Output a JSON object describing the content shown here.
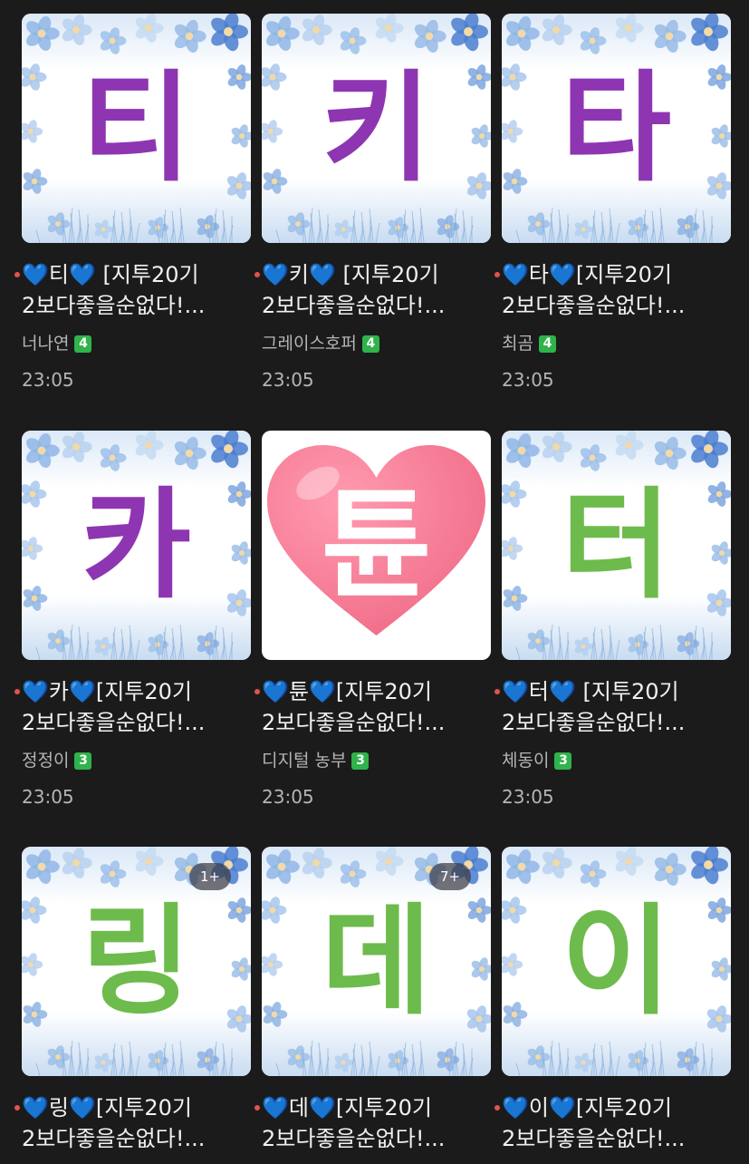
{
  "colors": {
    "background": "#1b1b1c",
    "purple_glyph": "#8e35b2",
    "green_glyph": "#6dbb4c",
    "heart": "#f06a86",
    "unread_dot": "#e0544a",
    "level_badge": "#2fb34a"
  },
  "posts": [
    {
      "glyph": "티",
      "glyph_color": "#8e35b2",
      "thumb_style": "flower-frame",
      "badge": "",
      "title_line1": "💙티💙 [지투20기",
      "title_line2": "2보다좋을순없다!...",
      "author": "너나연",
      "level": "4",
      "time": "23:05"
    },
    {
      "glyph": "키",
      "glyph_color": "#8e35b2",
      "thumb_style": "flower-frame",
      "badge": "",
      "title_line1": "💙키💙 [지투20기",
      "title_line2": "2보다좋을순없다!...",
      "author": "그레이스호퍼",
      "level": "4",
      "time": "23:05"
    },
    {
      "glyph": "타",
      "glyph_color": "#8e35b2",
      "thumb_style": "flower-frame",
      "badge": "",
      "title_line1": "💙타💙[지투20기",
      "title_line2": "2보다좋을순없다!...",
      "author": "최곰",
      "level": "4",
      "time": "23:05"
    },
    {
      "glyph": "카",
      "glyph_color": "#8e35b2",
      "thumb_style": "flower-frame",
      "badge": "",
      "title_line1": "💙카💙[지투20기",
      "title_line2": "2보다좋을순없다!...",
      "author": "정정이",
      "level": "3",
      "time": "23:05"
    },
    {
      "glyph": "튠",
      "glyph_color": "#ffffff",
      "thumb_style": "heart",
      "badge": "",
      "title_line1": "💙튠💙[지투20기",
      "title_line2": "2보다좋을순없다!...",
      "author": "디지털 농부",
      "level": "3",
      "time": "23:05"
    },
    {
      "glyph": "터",
      "glyph_color": "#6dbb4c",
      "thumb_style": "flower-frame",
      "badge": "",
      "title_line1": "💙터💙 [지투20기",
      "title_line2": "2보다좋을순없다!...",
      "author": "체동이",
      "level": "3",
      "time": "23:05"
    },
    {
      "glyph": "링",
      "glyph_color": "#6dbb4c",
      "thumb_style": "flower-frame",
      "badge": "1+",
      "title_line1": "💙링💙[지투20기",
      "title_line2": "2보다좋을순없다!...",
      "author": "",
      "level": "",
      "time": ""
    },
    {
      "glyph": "데",
      "glyph_color": "#6dbb4c",
      "thumb_style": "flower-frame",
      "badge": "7+",
      "title_line1": "💙데💙[지투20기",
      "title_line2": "2보다좋을순없다!...",
      "author": "",
      "level": "",
      "time": ""
    },
    {
      "glyph": "이",
      "glyph_color": "#6dbb4c",
      "thumb_style": "flower-frame",
      "badge": "",
      "title_line1": "💙이💙[지투20기",
      "title_line2": "2보다좋을순없다!...",
      "author": "",
      "level": "",
      "time": ""
    }
  ]
}
